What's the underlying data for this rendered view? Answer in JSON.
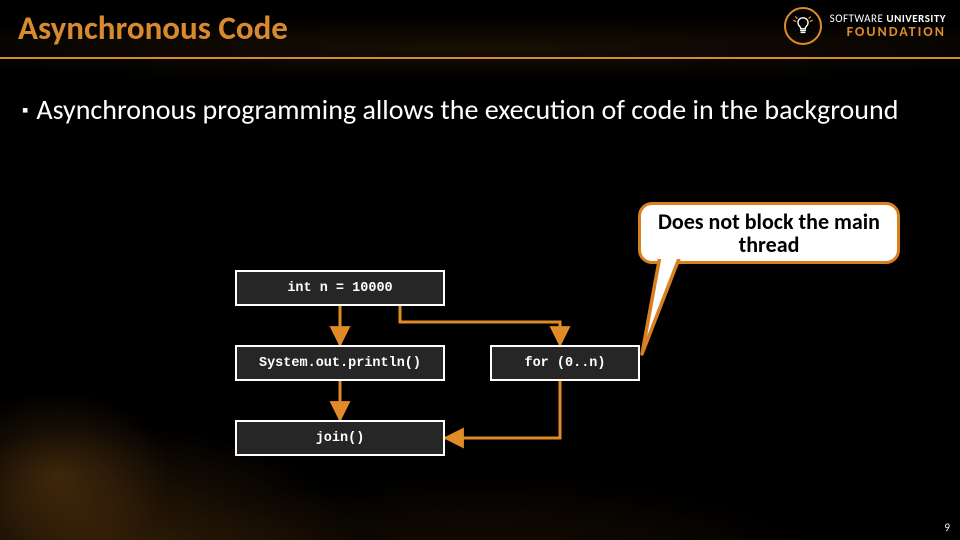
{
  "title": "Asynchronous Code",
  "logo": {
    "line1_light": "SOFTWARE",
    "line1_bold": "UNIVERSITY",
    "line2": "FOUNDATION"
  },
  "bullet": "Asynchronous programming allows the execution of code in the background",
  "callout": "Does not block the main thread",
  "boxes": {
    "init": "int n = 10000",
    "print": "System.out.println()",
    "forloop": "for (0..n)",
    "join": "join()"
  },
  "page_number": "9",
  "colors": {
    "accent": "#d88a2e",
    "arrow": "#e08a28"
  }
}
